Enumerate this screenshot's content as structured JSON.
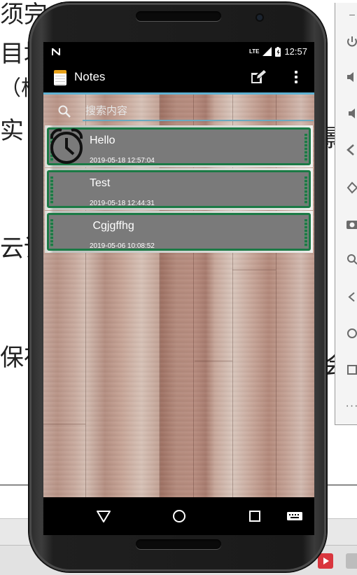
{
  "background_document": {
    "lines": [
      "须完成",
      "目均",
      "（柱",
      "实",
      "云论",
      "保存"
    ],
    "right_glyphs": [
      "影",
      "会"
    ]
  },
  "status_bar": {
    "network": "LTE",
    "time": "12:57"
  },
  "action_bar": {
    "title": "Notes",
    "app_icon": "notepad-icon",
    "new_note_icon": "edit-note-icon",
    "overflow_icon": "overflow-menu-icon"
  },
  "search": {
    "placeholder": "搜索内容",
    "value": ""
  },
  "notes": [
    {
      "title": "Hello",
      "date": "2019-05-18 12:57:04",
      "has_alarm": true
    },
    {
      "title": "Test",
      "date": "2019-05-18 12:44:31",
      "has_alarm": false
    },
    {
      "title": " Cgjgffhg",
      "date": "2019-05-06 10:08:52",
      "has_alarm": false
    }
  ],
  "nav_bar": {
    "back_icon": "back-triangle-icon",
    "home_icon": "home-circle-icon",
    "recents_icon": "recents-square-icon",
    "keyboard_icon": "keyboard-icon"
  },
  "colors": {
    "accent": "#5fb2d3",
    "note_border": "#1b7a45",
    "note_fill": "#7a7a7a"
  }
}
